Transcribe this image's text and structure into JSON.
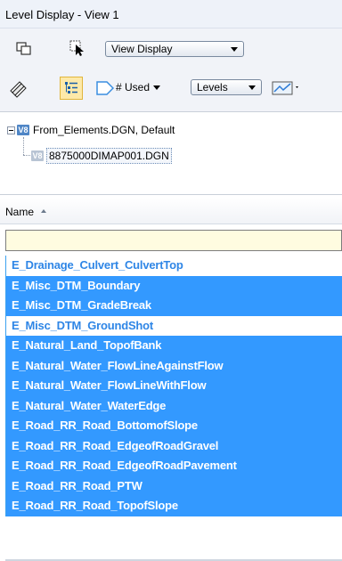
{
  "window": {
    "title": "Level Display - View 1"
  },
  "toolbar1": {
    "icons": [
      "copy-window-icon",
      "cursor-select-icon"
    ],
    "display_combo": {
      "value": "View Display"
    }
  },
  "toolbar2": {
    "icons": [
      "level-book-icon",
      "tree-list-icon",
      "filter-tag-icon",
      "edit-line-icon"
    ],
    "used_dropdown": {
      "label": "# Used"
    },
    "levels_combo": {
      "value": "Levels"
    }
  },
  "tree": {
    "root": {
      "label": "From_Elements.DGN, Default",
      "icon": "v8",
      "expander": "collapse-icon"
    },
    "child": {
      "label": "8875000DIMAP001.DGN",
      "icon": "v8"
    }
  },
  "list": {
    "column_header": "Name",
    "filter_value": "",
    "items": [
      {
        "label": "E_Drainage_Culvert_CulvertTop",
        "selected": false
      },
      {
        "label": "E_Misc_DTM_Boundary",
        "selected": true
      },
      {
        "label": "E_Misc_DTM_GradeBreak",
        "selected": true
      },
      {
        "label": "E_Misc_DTM_GroundShot",
        "selected": false
      },
      {
        "label": "E_Natural_Land_TopofBank",
        "selected": true
      },
      {
        "label": "E_Natural_Water_FlowLineAgainstFlow",
        "selected": true
      },
      {
        "label": "E_Natural_Water_FlowLineWithFlow",
        "selected": true
      },
      {
        "label": "E_Natural_Water_WaterEdge",
        "selected": true
      },
      {
        "label": "E_Road_RR_Road_BottomofSlope",
        "selected": true
      },
      {
        "label": "E_Road_RR_Road_EdgeofRoadGravel",
        "selected": true
      },
      {
        "label": "E_Road_RR_Road_EdgeofRoadPavement",
        "selected": true
      },
      {
        "label": "E_Road_RR_Road_PTW",
        "selected": true
      },
      {
        "label": "E_Road_RR_Road_TopofSlope",
        "selected": true
      }
    ]
  },
  "colors": {
    "selection": "#3399ff",
    "unselected_text": "#2f86e6",
    "filter_background": "#fffce0"
  }
}
